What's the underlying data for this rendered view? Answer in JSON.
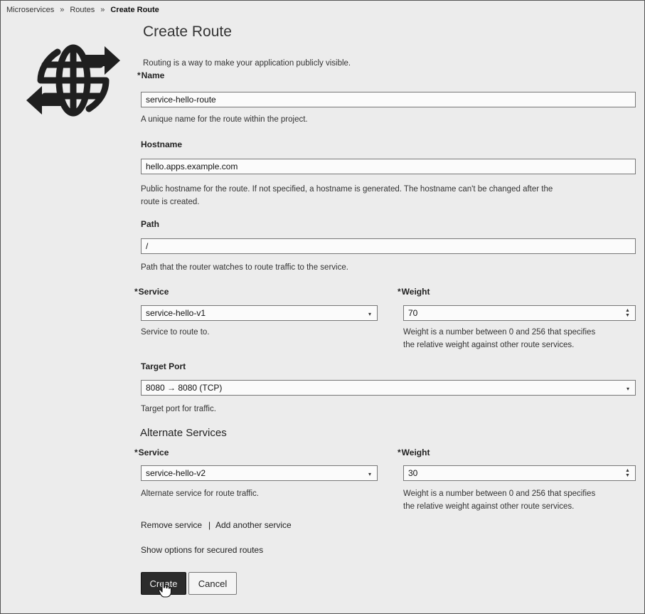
{
  "breadcrumb": {
    "items": [
      "Microservices",
      "Routes",
      "Create Route"
    ],
    "separator": "»"
  },
  "page": {
    "title": "Create Route",
    "intro": "Routing is a way to make your application publicly visible."
  },
  "required_marker": "*",
  "form": {
    "name": {
      "label": "Name",
      "value": "service-hello-route",
      "help": "A unique name for the route within the project."
    },
    "hostname": {
      "label": "Hostname",
      "value": "hello.apps.example.com",
      "help_line1": "Public hostname for the route. If not specified, a hostname is generated. The hostname can't be changed after the",
      "help_line2": "route is created."
    },
    "path": {
      "label": "Path",
      "value": "/",
      "help": "Path that the router watches to route traffic to the service."
    },
    "service": {
      "label": "Service",
      "value": "service-hello-v1",
      "help": "Service to route to."
    },
    "weight": {
      "label": "Weight",
      "value": "70",
      "help_line1": "Weight is a number between 0 and 256 that specifies",
      "help_line2": "the relative weight against other route services."
    },
    "target_port": {
      "label": "Target Port",
      "value": "8080 → 8080 (TCP)",
      "help": "Target port for traffic."
    }
  },
  "alternate": {
    "title": "Alternate Services",
    "service": {
      "label": "Service",
      "value": "service-hello-v2",
      "help": "Alternate service for route traffic."
    },
    "weight": {
      "label": "Weight",
      "value": "30",
      "help_line1": "Weight is a number between 0 and 256 that specifies",
      "help_line2": "the relative weight against other route services."
    },
    "remove_link": "Remove service",
    "link_separator": "|",
    "add_link": "Add another service"
  },
  "secured_routes_link": "Show options for secured routes",
  "buttons": {
    "create": "Create",
    "cancel": "Cancel"
  },
  "icons": {
    "caret": "▾",
    "spin_up": "▲",
    "spin_down": "▼",
    "logo": "globe-routing-icon",
    "cursor": "hand-pointer-icon"
  }
}
